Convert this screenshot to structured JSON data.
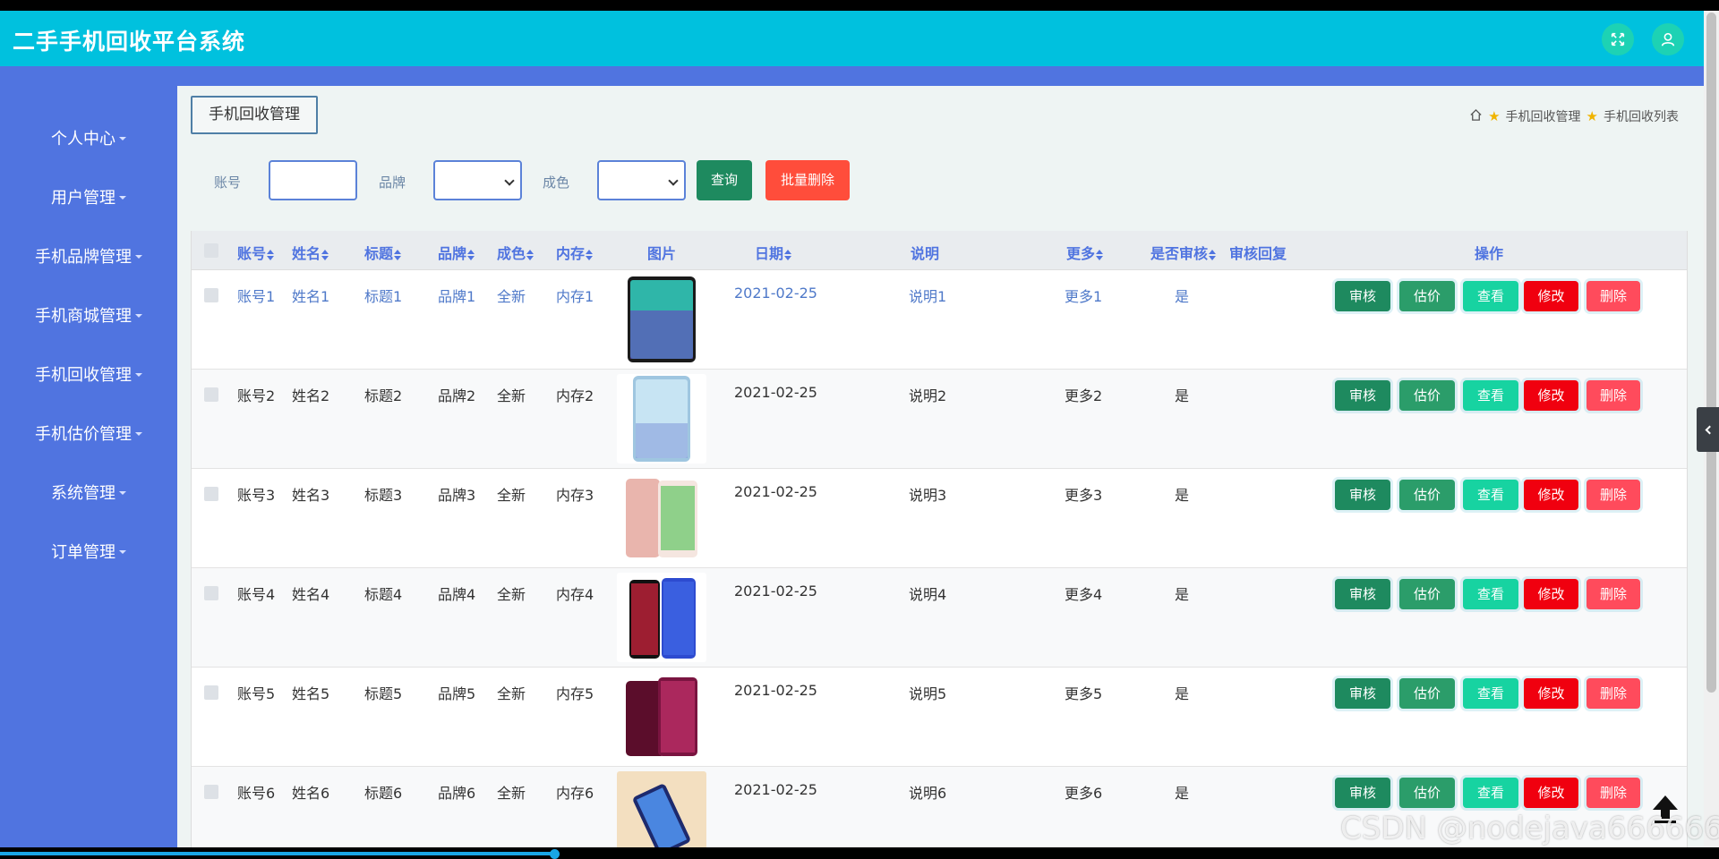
{
  "header": {
    "title": "二手手机回收平台系统",
    "icons": [
      "fullscreen-icon",
      "user-icon"
    ],
    "accent_color": "#00c1de"
  },
  "sidebar": {
    "color": "#5074e0",
    "items": [
      {
        "label": "个人中心"
      },
      {
        "label": "用户管理"
      },
      {
        "label": "手机品牌管理"
      },
      {
        "label": "手机商城管理"
      },
      {
        "label": "手机回收管理"
      },
      {
        "label": "手机估价管理"
      },
      {
        "label": "系统管理"
      },
      {
        "label": "订单管理"
      }
    ]
  },
  "page": {
    "tab_label": "手机回收管理",
    "breadcrumb": [
      "手机回收管理",
      "手机回收列表"
    ]
  },
  "search": {
    "account_label": "账号",
    "account_value": "",
    "brand_label": "品牌",
    "brand_value": "",
    "condition_label": "成色",
    "condition_value": "",
    "query_button": "查询",
    "batch_delete_button": "批量删除"
  },
  "table": {
    "columns": [
      "账号",
      "姓名",
      "标题",
      "品牌",
      "成色",
      "内存",
      "图片",
      "日期",
      "说明",
      "更多",
      "是否审核",
      "审核回复",
      "操作"
    ],
    "actions": [
      "审核",
      "估价",
      "查看",
      "修改",
      "删除"
    ],
    "rows": [
      {
        "account": "账号1",
        "name": "姓名1",
        "title": "标题1",
        "brand": "品牌1",
        "condition": "全新",
        "memory": "内存1",
        "date": "2021-02-25",
        "desc": "说明1",
        "more": "更多1",
        "audited": "是",
        "reply": ""
      },
      {
        "account": "账号2",
        "name": "姓名2",
        "title": "标题2",
        "brand": "品牌2",
        "condition": "全新",
        "memory": "内存2",
        "date": "2021-02-25",
        "desc": "说明2",
        "more": "更多2",
        "audited": "是",
        "reply": ""
      },
      {
        "account": "账号3",
        "name": "姓名3",
        "title": "标题3",
        "brand": "品牌3",
        "condition": "全新",
        "memory": "内存3",
        "date": "2021-02-25",
        "desc": "说明3",
        "more": "更多3",
        "audited": "是",
        "reply": ""
      },
      {
        "account": "账号4",
        "name": "姓名4",
        "title": "标题4",
        "brand": "品牌4",
        "condition": "全新",
        "memory": "内存4",
        "date": "2021-02-25",
        "desc": "说明4",
        "more": "更多4",
        "audited": "是",
        "reply": ""
      },
      {
        "account": "账号5",
        "name": "姓名5",
        "title": "标题5",
        "brand": "品牌5",
        "condition": "全新",
        "memory": "内存5",
        "date": "2021-02-25",
        "desc": "说明5",
        "more": "更多5",
        "audited": "是",
        "reply": ""
      },
      {
        "account": "账号6",
        "name": "姓名6",
        "title": "标题6",
        "brand": "品牌6",
        "condition": "全新",
        "memory": "内存6",
        "date": "2021-02-25",
        "desc": "说明6",
        "more": "更多6",
        "audited": "是",
        "reply": ""
      }
    ]
  },
  "watermark": "CSDN @nodejava666666"
}
